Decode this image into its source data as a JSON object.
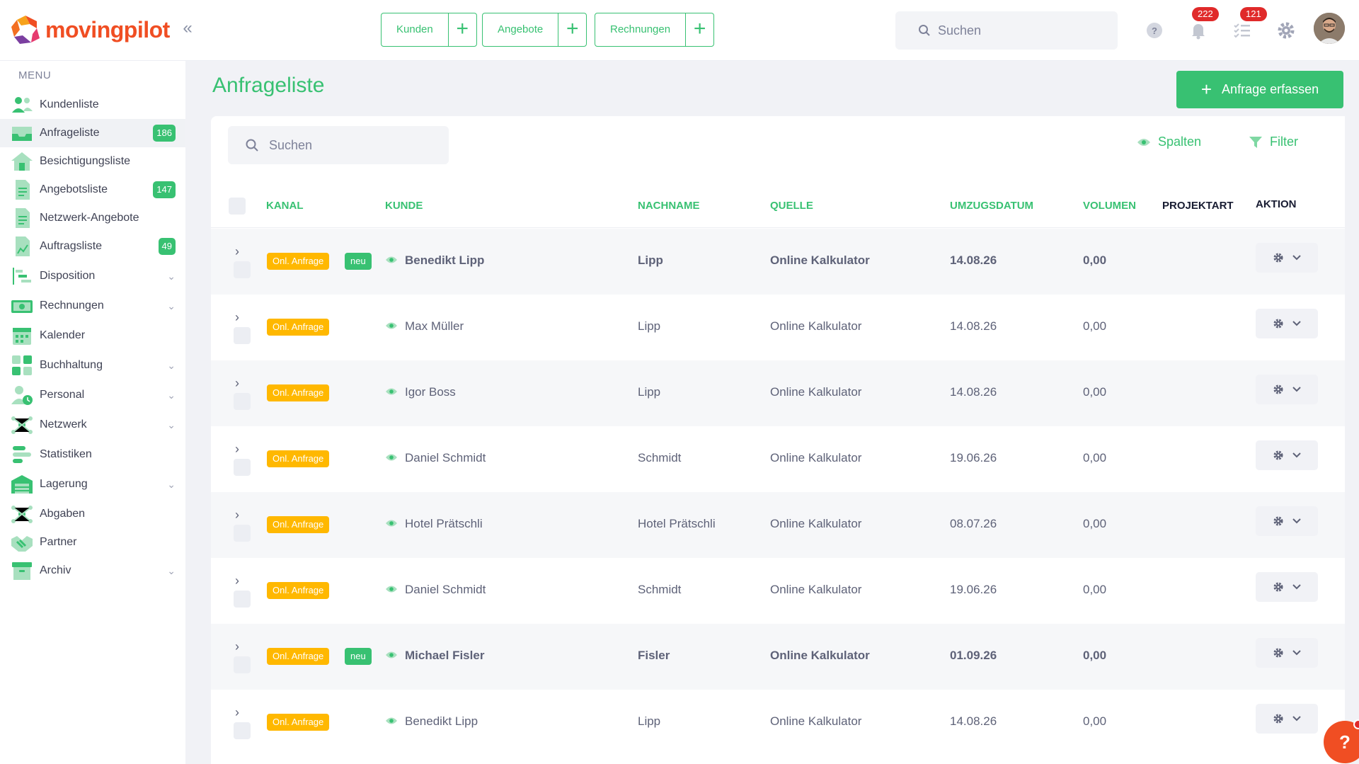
{
  "header": {
    "logo": "movingpilot",
    "collapse": "«",
    "quick_actions": [
      {
        "label": "Kunden"
      },
      {
        "label": "Angebote"
      },
      {
        "label": "Rechnungen"
      }
    ],
    "search_placeholder": "Suchen",
    "notifications_count": "222",
    "tasks_count": "121",
    "icons": [
      "help-icon",
      "bell-icon",
      "tasks-icon",
      "gear-icon"
    ]
  },
  "sidebar": {
    "menu_title": "MENU",
    "items": [
      {
        "label": "Kundenliste",
        "icon": "users-icon"
      },
      {
        "label": "Anfrageliste",
        "icon": "inbox-icon",
        "count": "186",
        "active": true
      },
      {
        "label": "Besichtigungsliste",
        "icon": "house-icon"
      },
      {
        "label": "Angebotsliste",
        "icon": "document-icon",
        "count": "147"
      },
      {
        "label": "Netzwerk-Angebote",
        "icon": "document-icon"
      },
      {
        "label": "Auftragsliste",
        "icon": "document-chart-icon",
        "count": "49"
      },
      {
        "label": "Disposition",
        "icon": "gantt-icon",
        "expandable": true
      },
      {
        "label": "Rechnungen",
        "icon": "money-icon",
        "expandable": true
      },
      {
        "label": "Kalender",
        "icon": "calendar-icon"
      },
      {
        "label": "Buchhaltung",
        "icon": "calculator-icon",
        "expandable": true
      },
      {
        "label": "Personal",
        "icon": "person-clock-icon",
        "expandable": true
      },
      {
        "label": "Netzwerk",
        "icon": "network-icon",
        "expandable": true
      },
      {
        "label": "Statistiken",
        "icon": "bars-icon"
      },
      {
        "label": "Lagerung",
        "icon": "warehouse-icon",
        "expandable": true
      },
      {
        "label": "Abgaben",
        "icon": "network-icon"
      },
      {
        "label": "Partner",
        "icon": "handshake-icon"
      },
      {
        "label": "Archiv",
        "icon": "archive-icon",
        "expandable": true
      }
    ]
  },
  "main": {
    "title": "Anfrageliste",
    "add_button": "Anfrage erfassen",
    "search_placeholder": "Suchen",
    "columns_button": "Spalten",
    "filter_button": "Filter",
    "columns": [
      "KANAL",
      "KUNDE",
      "NACHNAME",
      "QUELLE",
      "UMZUGSDATUM",
      "VOLUMEN",
      "PROJEKTART",
      "AKTION"
    ],
    "rows": [
      {
        "kanal": "Onl. Anfrage",
        "neu": "neu",
        "kunde": "Benedikt Lipp",
        "nachname": "Lipp",
        "quelle": "Online Kalkulator",
        "datum": "14.08.26",
        "volumen": "0,00",
        "bold": true
      },
      {
        "kanal": "Onl. Anfrage",
        "neu": "",
        "kunde": "Max Müller",
        "nachname": "Lipp",
        "quelle": "Online Kalkulator",
        "datum": "14.08.26",
        "volumen": "0,00",
        "bold": false
      },
      {
        "kanal": "Onl. Anfrage",
        "neu": "",
        "kunde": "Igor Boss",
        "nachname": "Lipp",
        "quelle": "Online Kalkulator",
        "datum": "14.08.26",
        "volumen": "0,00",
        "bold": false
      },
      {
        "kanal": "Onl. Anfrage",
        "neu": "",
        "kunde": "Daniel Schmidt",
        "nachname": "Schmidt",
        "quelle": "Online Kalkulator",
        "datum": "19.06.26",
        "volumen": "0,00",
        "bold": false
      },
      {
        "kanal": "Onl. Anfrage",
        "neu": "",
        "kunde": "Hotel Prätschli",
        "nachname": "Hotel Prätschli",
        "quelle": "Online Kalkulator",
        "datum": "08.07.26",
        "volumen": "0,00",
        "bold": false
      },
      {
        "kanal": "Onl. Anfrage",
        "neu": "",
        "kunde": "Daniel Schmidt",
        "nachname": "Schmidt",
        "quelle": "Online Kalkulator",
        "datum": "19.06.26",
        "volumen": "0,00",
        "bold": false
      },
      {
        "kanal": "Onl. Anfrage",
        "neu": "neu",
        "kunde": "Michael Fisler",
        "nachname": "Fisler",
        "quelle": "Online Kalkulator",
        "datum": "01.09.26",
        "volumen": "0,00",
        "bold": true
      },
      {
        "kanal": "Onl. Anfrage",
        "neu": "",
        "kunde": "Benedikt Lipp",
        "nachname": "Lipp",
        "quelle": "Online Kalkulator",
        "datum": "14.08.26",
        "volumen": "0,00",
        "bold": false
      }
    ]
  },
  "help_button": "?",
  "colors": {
    "accent": "#38c172",
    "brand": "#f04e23",
    "tag": "#ffb800",
    "badge": "#e02a2a"
  }
}
